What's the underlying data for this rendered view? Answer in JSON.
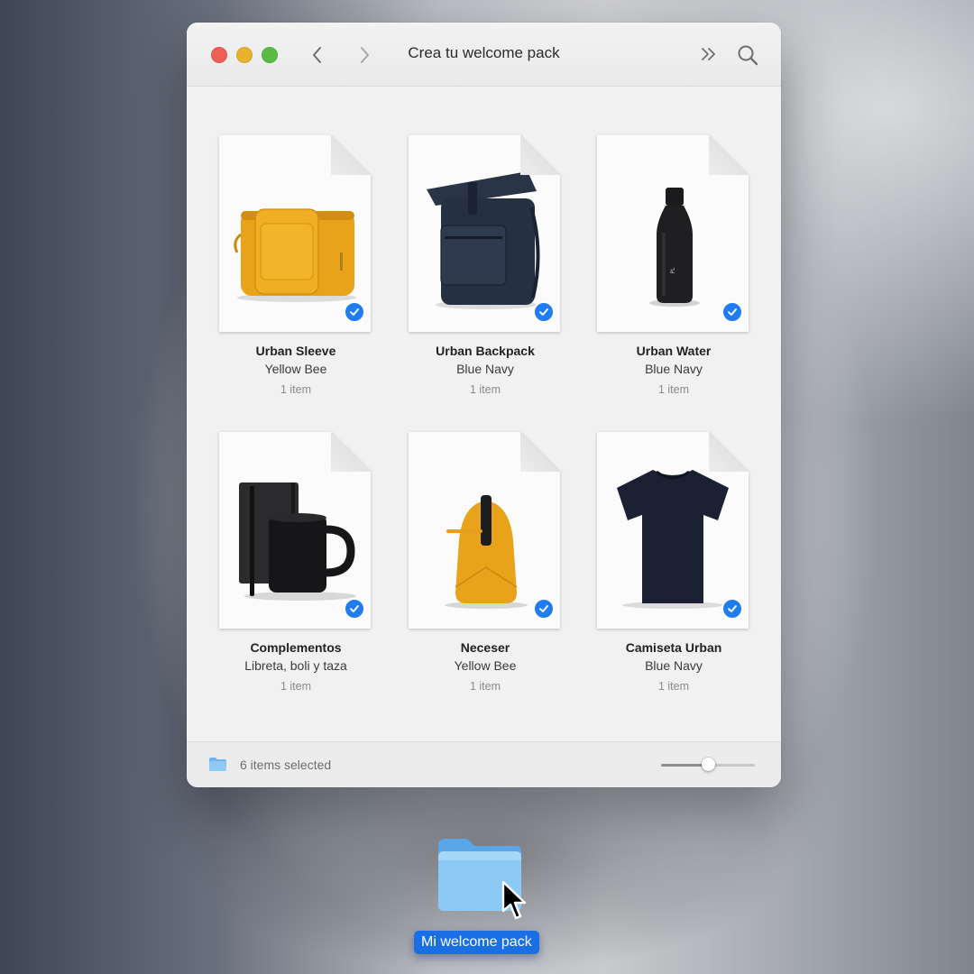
{
  "window": {
    "title": "Crea tu welcome pack",
    "traffic_lights": [
      "close",
      "minimize",
      "zoom"
    ],
    "toolbar": {
      "back_icon": "chevron-left-icon",
      "forward_icon": "chevron-right-icon",
      "more_icon": "double-chevron-icon",
      "search_icon": "magnifier-icon"
    }
  },
  "items": [
    {
      "name": "Urban Sleeve",
      "variant": "Yellow Bee",
      "count": "1 item",
      "selected": true,
      "product": "yellow-laptop-sleeve"
    },
    {
      "name": "Urban Backpack",
      "variant": "Blue Navy",
      "count": "1 item",
      "selected": true,
      "product": "navy-rolltop-backpack"
    },
    {
      "name": "Urban Water",
      "variant": "Blue Navy",
      "count": "1 item",
      "selected": true,
      "product": "black-water-bottle"
    },
    {
      "name": "Complementos",
      "variant": "Libreta, boli y taza",
      "count": "1 item",
      "selected": true,
      "product": "notebook-pen-mug"
    },
    {
      "name": "Neceser",
      "variant": "Yellow Bee",
      "count": "1 item",
      "selected": true,
      "product": "yellow-toiletry-bag"
    },
    {
      "name": "Camiseta Urban",
      "variant": "Blue Navy",
      "count": "1 item",
      "selected": true,
      "product": "navy-tshirt"
    }
  ],
  "statusbar": {
    "text": "6 items selected",
    "zoom_level": 0.5
  },
  "desktop_folder": {
    "label": "Mi welcome pack"
  },
  "colors": {
    "accent": "#1f7df1",
    "selection_label": "#1a6fe4",
    "yellow_bee": "#e8a31a",
    "blue_navy": "#1f2738"
  }
}
